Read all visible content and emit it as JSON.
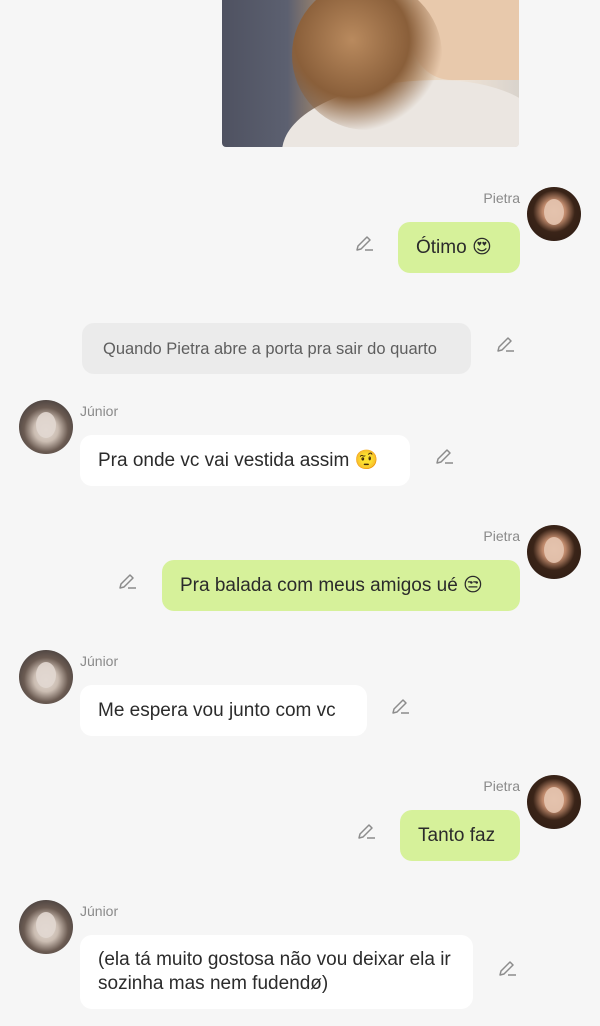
{
  "chat": {
    "messages": [
      {
        "sender": "Pietra",
        "side": "right",
        "text": "Ótimo 😍"
      },
      {
        "sender": "",
        "side": "narration",
        "text": "Quando Pietra abre a porta pra sair do quarto"
      },
      {
        "sender": "Júnior",
        "side": "left",
        "text": "Pra onde vc vai vestida assim 🤨"
      },
      {
        "sender": "Pietra",
        "side": "right",
        "text": "Pra balada com meus amigos ué 😒"
      },
      {
        "sender": "Júnior",
        "side": "left",
        "text": "Me espera vou junto com vc"
      },
      {
        "sender": "Pietra",
        "side": "right",
        "text": "Tanto faz"
      },
      {
        "sender": "Júnior",
        "side": "left",
        "text": "(ela tá muito gostosa não vou deixar ela ir sozinha mas nem fudendø)"
      }
    ]
  },
  "icons": {
    "edit": "pencil-icon"
  },
  "colors": {
    "background": "#f6f6f6",
    "my_bubble": "#d6f19a",
    "other_bubble": "#ffffff",
    "narration_bubble": "#ebebeb",
    "name_text": "#8a8a8a"
  }
}
